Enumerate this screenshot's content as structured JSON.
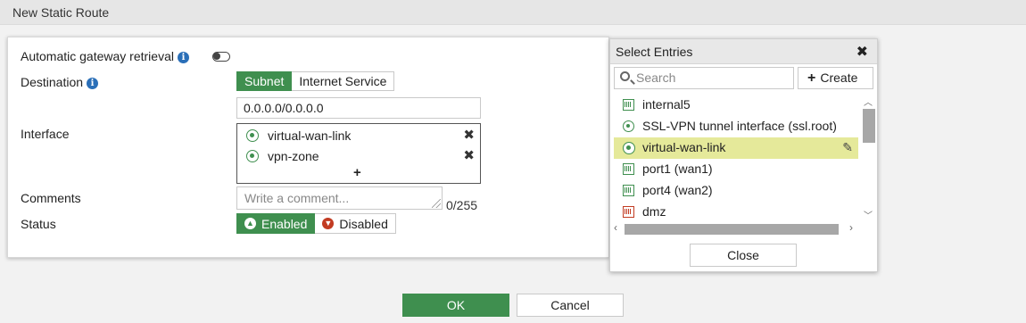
{
  "window": {
    "title": "New Static Route"
  },
  "form": {
    "auto_gateway_label": "Automatic gateway retrieval",
    "auto_gateway_enabled": false,
    "destination_label": "Destination",
    "destination_options": [
      "Subnet",
      "Internet Service"
    ],
    "destination_selected": "Subnet",
    "destination_value": "0.0.0.0/0.0.0.0",
    "interface_label": "Interface",
    "interfaces": [
      {
        "name": "virtual-wan-link",
        "icon": "sd-wan-icon"
      },
      {
        "name": "vpn-zone",
        "icon": "sd-wan-icon"
      }
    ],
    "add_symbol": "+",
    "remove_symbol": "✖",
    "comments_label": "Comments",
    "comments_placeholder": "Write a comment...",
    "comments_count": "0/255",
    "status_label": "Status",
    "status_enabled": "Enabled",
    "status_disabled": "Disabled",
    "status_selected": "Enabled"
  },
  "entries": {
    "title": "Select Entries",
    "close_symbol": "✖",
    "search_placeholder": "Search",
    "create_label": "Create",
    "create_symbol": "+",
    "items": [
      {
        "label": "internal5",
        "icon": "port-icon"
      },
      {
        "label": "SSL-VPN tunnel interface (ssl.root)",
        "icon": "ssl-vpn-icon"
      },
      {
        "label": "virtual-wan-link",
        "icon": "sd-wan-icon",
        "selected": true
      },
      {
        "label": "port1 (wan1)",
        "icon": "port-icon"
      },
      {
        "label": "port4 (wan2)",
        "icon": "port-icon"
      },
      {
        "label": "dmz",
        "icon": "port-icon-red"
      }
    ],
    "close_button": "Close"
  },
  "footer": {
    "ok": "OK",
    "cancel": "Cancel"
  },
  "colors": {
    "accent": "#3f8f4f",
    "selected_row": "#e5e99a",
    "danger": "#c23b22",
    "info": "#2a6fb8"
  }
}
